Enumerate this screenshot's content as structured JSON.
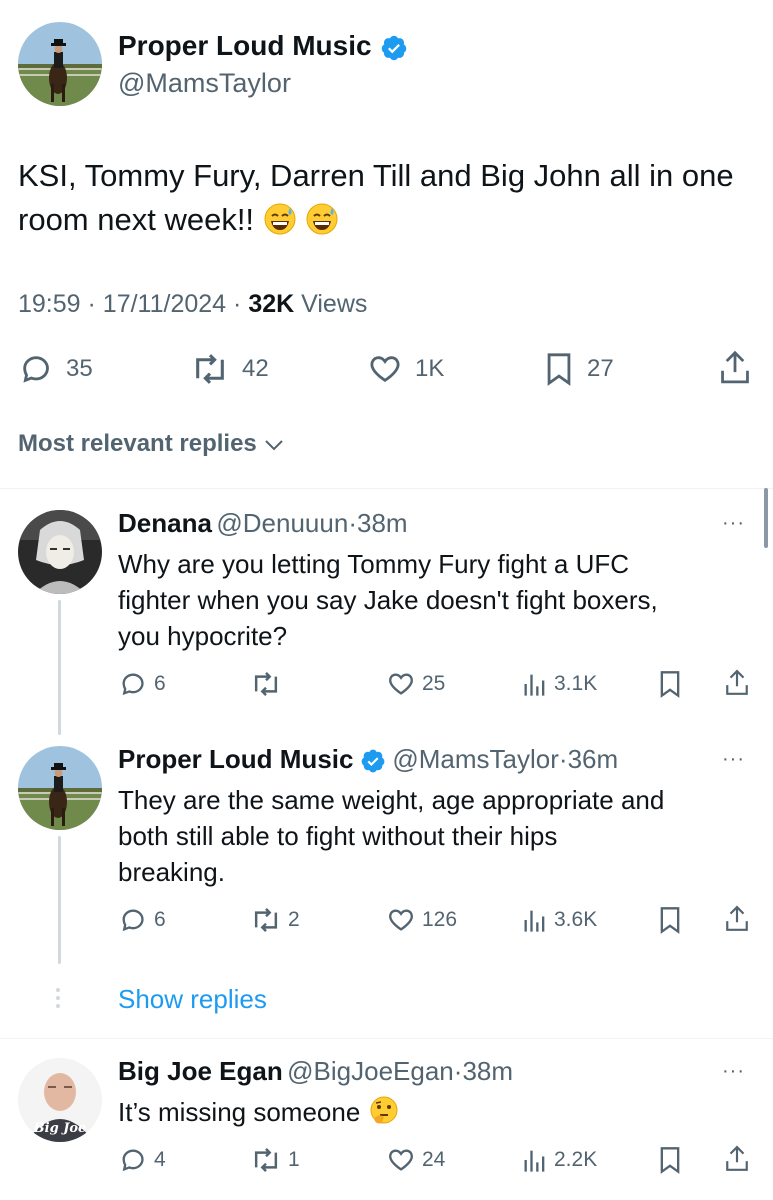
{
  "main_tweet": {
    "author_name": "Proper Loud Music",
    "author_handle": "@MamsTaylor",
    "text": "KSI, Tommy Fury, Darren Till and Big John all in one",
    "text_line2": "room next week!!",
    "emojis": [
      "grinning-sweat-emoji",
      "grinning-sweat-emoji"
    ],
    "time": "19:59",
    "date": "17/11/2024",
    "views_count": "32K",
    "views_label": "Views",
    "replies": "35",
    "reposts": "42",
    "likes": "1K",
    "bookmarks": "27"
  },
  "sort": {
    "label": "Most relevant replies"
  },
  "replies": [
    {
      "author_name": "Denana",
      "author_handle": "@Denuuun",
      "time": "38m",
      "lines": [
        "Why are you letting Tommy Fury fight a UFC",
        "fighter when you say Jake doesn't fight boxers,",
        "you hypocrite?"
      ],
      "replies": "6",
      "reposts": "",
      "likes": "25",
      "views": "3.1K"
    },
    {
      "author_name": "Proper Loud Music",
      "author_handle": "@MamsTaylor",
      "time": "36m",
      "lines": [
        "They are the same weight, age appropriate and",
        "both still able to fight without their hips",
        "breaking."
      ],
      "replies": "6",
      "reposts": "2",
      "likes": "126",
      "views": "3.6K"
    },
    {
      "author_name": "Big Joe Egan",
      "author_handle": "@BigJoeEgan",
      "time": "38m",
      "lines": [
        "It’s missing someone"
      ],
      "replies": "4",
      "reposts": "1",
      "likes": "24",
      "views": "2.2K",
      "avatar_text": "Big Joe"
    }
  ],
  "show_replies": "Show replies",
  "dot_sep": "·",
  "more_label": "···",
  "colors": {
    "accent": "#1d9bf0",
    "text": "#0f1419",
    "muted": "#536471",
    "divider": "#eff3f4"
  }
}
